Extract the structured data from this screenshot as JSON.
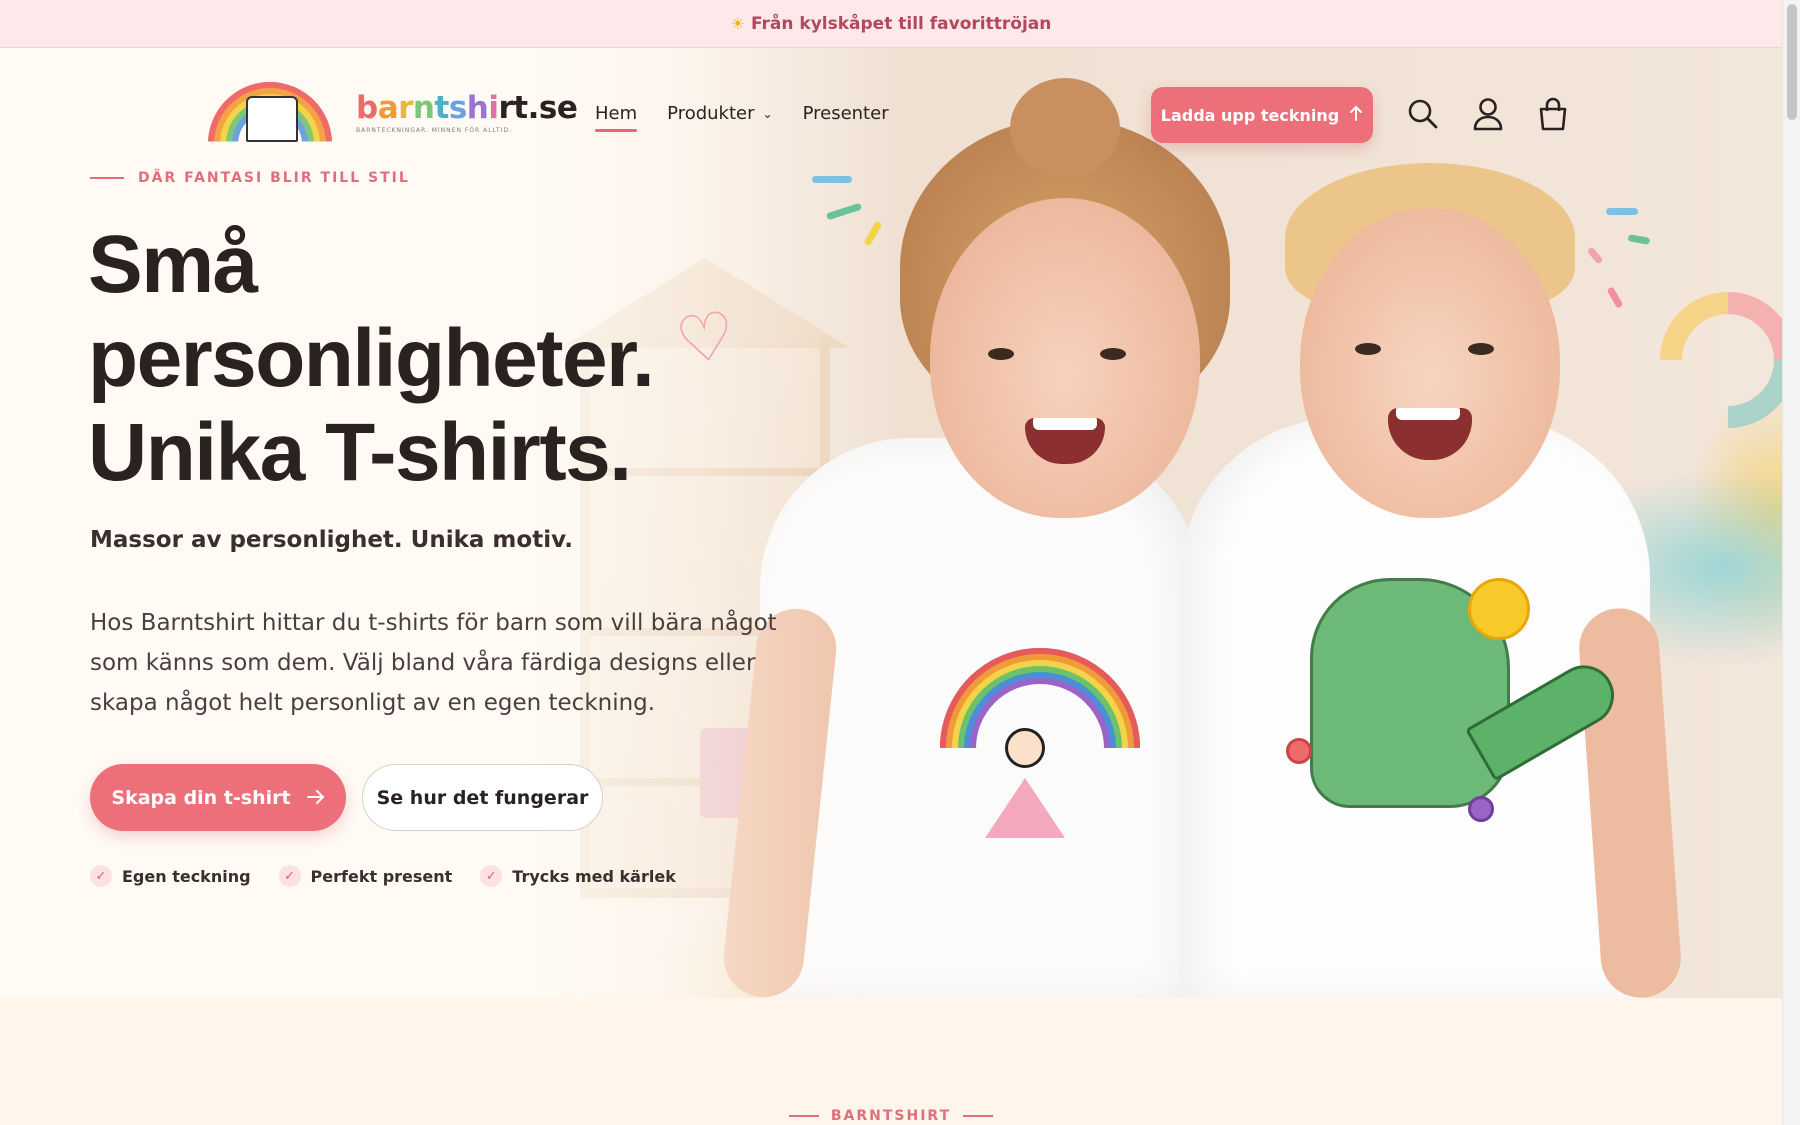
{
  "announcement": {
    "icon": "sun-icon",
    "text": "Från kylskåpet till favorittröjan"
  },
  "brand": {
    "name": "barntshirt.se",
    "tagline": "BARNTECKNINGAR. MINNEN FÖR ALLTID.",
    "logo_icon": "rainbow-tshirt-logo"
  },
  "nav": {
    "items": [
      {
        "label": "Hem",
        "active": true
      },
      {
        "label": "Produkter",
        "has_dropdown": true
      },
      {
        "label": "Presenter"
      }
    ]
  },
  "header_actions": {
    "upload_label": "Ladda upp teckning",
    "upload_icon": "arrow-up-icon",
    "search_icon": "search-icon",
    "account_icon": "user-icon",
    "cart_icon": "shopping-bag-icon"
  },
  "hero": {
    "eyebrow": "DÄR FANTASI BLIR TILL STIL",
    "headline_lines": [
      "Små",
      "personligheter.",
      "Unika T-shirts."
    ],
    "subhead": "Massor av personlighet. Unika motiv.",
    "paragraph": "Hos Barntshirt hittar du t-shirts för barn som vill bära något som känns som dem. Välj bland våra färdiga designs eller skapa något helt personligt av en egen teckning.",
    "cta_primary": "Skapa din t-shirt",
    "cta_primary_icon": "arrow-right-icon",
    "cta_secondary": "Se hur det fungerar",
    "features": [
      "Egen teckning",
      "Perfekt present",
      "Trycks med kärlek"
    ],
    "image": "two-laughing-kids-in-drawn-tshirts"
  },
  "section2": {
    "eyebrow": "BARNTSHIRT"
  },
  "colors": {
    "accent": "#ec6f7a",
    "announce_bg": "#fde8ea",
    "page_bg": "#fffaf3",
    "text": "#2a2220"
  }
}
